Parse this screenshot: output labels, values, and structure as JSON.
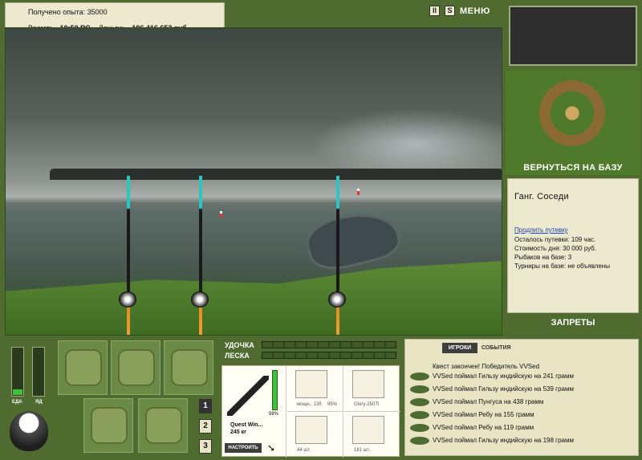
{
  "info": {
    "experience": "Получено опыта: 35000",
    "time_label": "Время:",
    "time_value": "10:50 ВС",
    "money_label": "Деньги:",
    "money_value": "196 416 653 руб."
  },
  "topbar": {
    "pause_label": "II",
    "sound_label": "S",
    "menu_label": "МЕНЮ"
  },
  "side": {
    "return_base": "ВЕРНУТЬСЯ НА БАЗУ",
    "bans": "ЗАПРЕТЫ"
  },
  "base": {
    "title": "Ганг. Соседи",
    "extend_link": "Продлить путевку",
    "lines": [
      "Осталось путевки: 109 час.",
      "Стоимость дня: 30 000 руб.",
      "Рыбаков на базе: 3",
      "Турниры на базе: не объявлены"
    ]
  },
  "status": {
    "food_label": "ЕДА",
    "poison_label": "ЯД",
    "food_level": 0.12,
    "poison_level": 0
  },
  "pages": [
    "1",
    "2",
    "3"
  ],
  "tackle": {
    "rod_label": "УДОЧКА",
    "line_label": "ЛЕСКА"
  },
  "gear": {
    "rod_name": "Quest Win...",
    "rod_weight": "245 кг",
    "rod_pct": "98%",
    "setup_label": "НАСТРОИТЬ",
    "reel_power": "мощн.: 135",
    "reel_pct": "95%",
    "lure_name": "Glory-250Ti",
    "hook_count": "44 шт.",
    "bait_count": "181 шт."
  },
  "events": {
    "tab_players": "ИГРОКИ",
    "tab_events": "СОБЫТИЯ",
    "quest": "Квест закончен! Победитель VVSed",
    "rows": [
      "VVSed поймал Гильзу индийскую на 241 грамм",
      "VVSed поймал Гильзу индийскую на 539 грамм",
      "VVSed поймал Пунгуса на 438 грамм",
      "VVSed поймал Ребу на 155 грамм",
      "VVSed поймал Ребу на 119 грамм",
      "VVSed поймал Гильзу индийскую на 198 грамм"
    ]
  }
}
